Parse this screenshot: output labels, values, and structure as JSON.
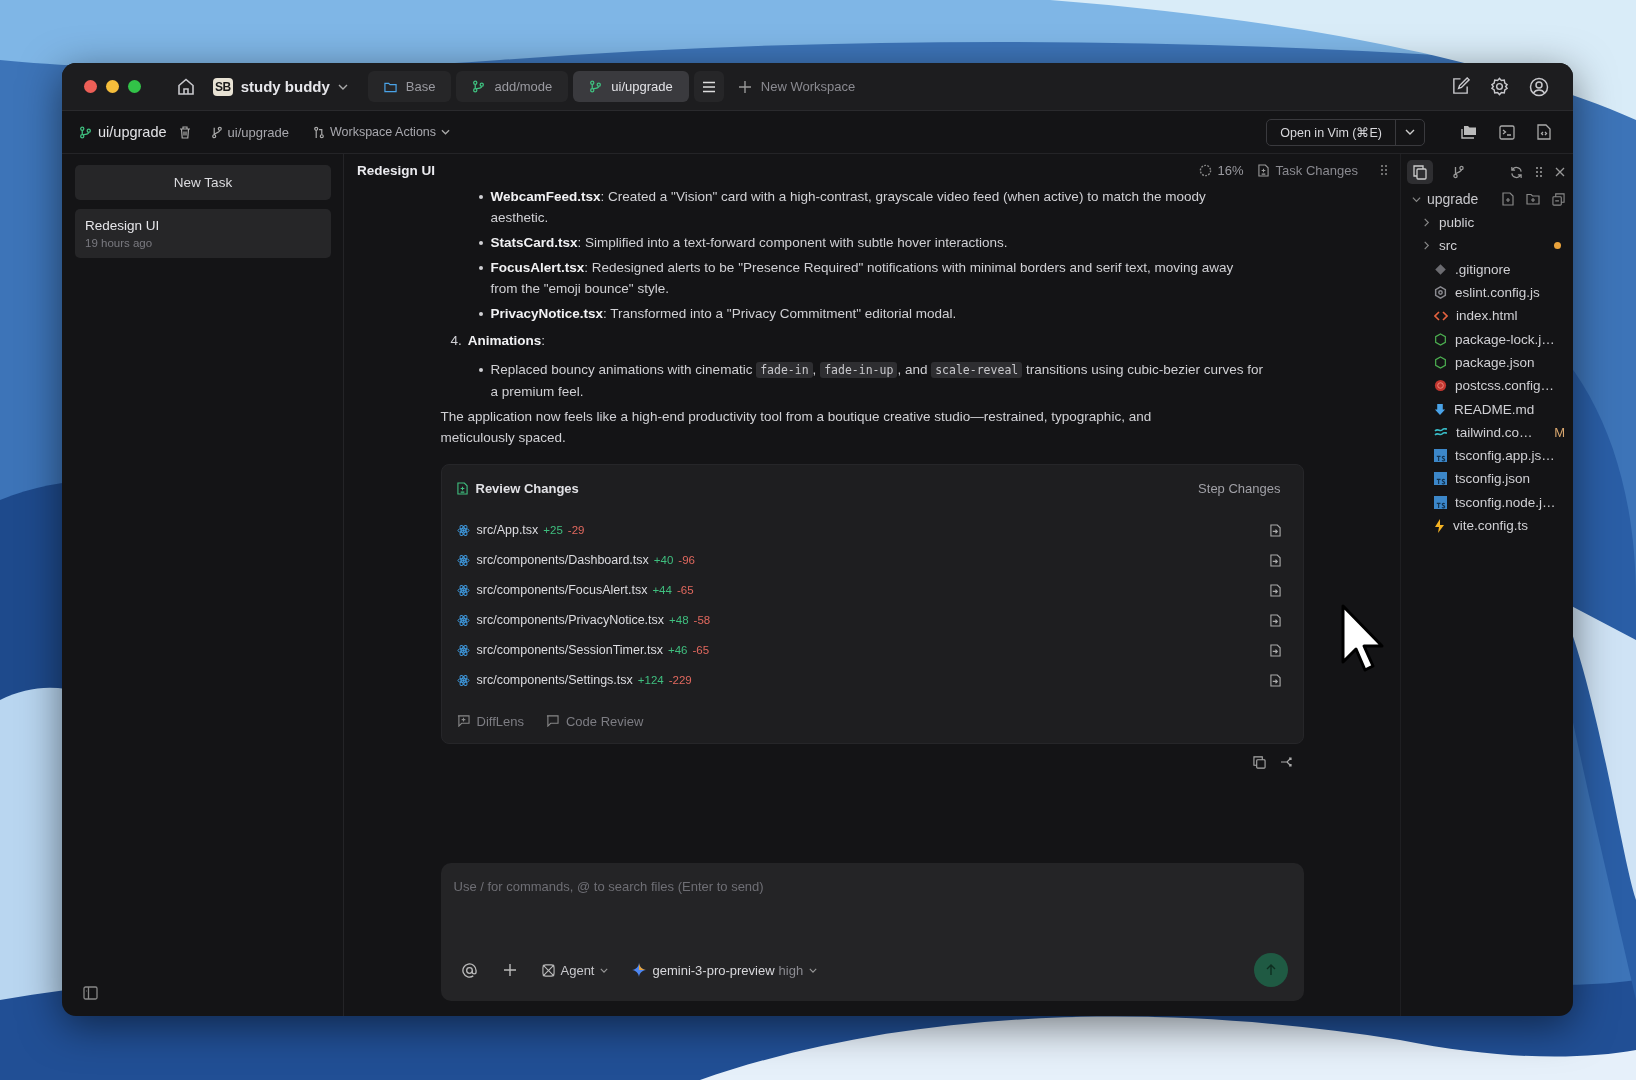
{
  "workspace": {
    "logo": "SB",
    "name": "study buddy"
  },
  "tabs": [
    {
      "label": "Base",
      "kind": "folder",
      "selected": false
    },
    {
      "label": "add/mode",
      "kind": "branch",
      "selected": false
    },
    {
      "label": "ui/upgrade",
      "kind": "branch",
      "selected": true
    }
  ],
  "new_workspace": "New Workspace",
  "toolbar": {
    "workspace": "ui/upgrade",
    "branch": "ui/upgrade",
    "actions": "Workspace Actions",
    "open_button": "Open in Vim (⌘E)"
  },
  "sidebar": {
    "new_task": "New Task",
    "tasks": [
      {
        "title": "Redesign UI",
        "time": "19 hours ago",
        "selected": true
      }
    ]
  },
  "task": {
    "title": "Redesign UI",
    "progress": "16%",
    "changes_button": "Task Changes"
  },
  "message": [
    {
      "kind": "bullets",
      "items": [
        {
          "parts": [
            {
              "kind": "rich",
              "text": "**WebcamFeed.tsx**: Created a \"Vision\" card with a high-contrast, grayscale video feed (when active) to match the moody aesthetic."
            }
          ]
        },
        {
          "parts": [
            {
              "kind": "rich",
              "text": "**StatsCard.tsx**: Simplified into a text-forward component with subtle hover interactions."
            }
          ]
        },
        {
          "parts": [
            {
              "kind": "rich",
              "text": "**FocusAlert.tsx**: Redesigned alerts to be \"Presence Required\" notifications with minimal borders and serif text, moving away from the \"emoji bounce\" style."
            }
          ]
        },
        {
          "parts": [
            {
              "kind": "rich",
              "text": "**PrivacyNotice.tsx**: Transformed into a \"Privacy Commitment\" editorial modal."
            }
          ]
        }
      ]
    },
    {
      "kind": "numbered",
      "number": "4.",
      "title": "Animations",
      "suffix": ":",
      "items": [
        {
          "parts": [
            {
              "kind": "rich",
              "text": "Replaced bouncy animations with cinematic "
            },
            {
              "kind": "code",
              "text": "fade-in"
            },
            {
              "kind": "rich",
              "text": ", "
            },
            {
              "kind": "code",
              "text": "fade-in-up"
            },
            {
              "kind": "rich",
              "text": ", and "
            },
            {
              "kind": "code",
              "text": "scale-reveal"
            },
            {
              "kind": "rich",
              "text": " transitions using cubic-bezier curves for a premium feel."
            }
          ]
        }
      ]
    },
    {
      "kind": "paragraph",
      "text": "The application now feels like a high-end productivity tool from a boutique creative studio—restrained, typographic, and meticulously spaced."
    }
  ],
  "review": {
    "title": "Review Changes",
    "step_button": "Step Changes",
    "files": [
      {
        "path": "src/App.tsx",
        "added": "+25",
        "removed": "-29"
      },
      {
        "path": "src/components/Dashboard.tsx",
        "added": "+40",
        "removed": "-96"
      },
      {
        "path": "src/components/FocusAlert.tsx",
        "added": "+44",
        "removed": "-65"
      },
      {
        "path": "src/components/PrivacyNotice.tsx",
        "added": "+48",
        "removed": "-58"
      },
      {
        "path": "src/components/SessionTimer.tsx",
        "added": "+46",
        "removed": "-65"
      },
      {
        "path": "src/components/Settings.tsx",
        "added": "+124",
        "removed": "-229"
      }
    ],
    "footer": [
      "DiffLens",
      "Code Review"
    ]
  },
  "composer": {
    "placeholder": "Use / for commands, @ to search files (Enter to send)",
    "mode": "Agent",
    "model": "gemini-3-pro-preview",
    "effort": "high"
  },
  "file_tree": {
    "root": "upgrade",
    "expanded": true,
    "items": [
      {
        "name": "public",
        "kind": "folder",
        "expanded": false,
        "modified": false
      },
      {
        "name": "src",
        "kind": "folder",
        "expanded": false,
        "modified": true
      },
      {
        "name": ".gitignore",
        "kind": "git"
      },
      {
        "name": "eslint.config.js",
        "kind": "eslint"
      },
      {
        "name": "index.html",
        "kind": "html"
      },
      {
        "name": "package-lock.j…",
        "kind": "json"
      },
      {
        "name": "package.json",
        "kind": "json"
      },
      {
        "name": "postcss.config…",
        "kind": "postcss"
      },
      {
        "name": "README.md",
        "kind": "markdown"
      },
      {
        "name": "tailwind.co…",
        "kind": "tailwind",
        "badge": "M"
      },
      {
        "name": "tsconfig.app.js…",
        "kind": "ts"
      },
      {
        "name": "tsconfig.json",
        "kind": "ts"
      },
      {
        "name": "tsconfig.node.j…",
        "kind": "ts"
      },
      {
        "name": "vite.config.ts",
        "kind": "vite"
      }
    ]
  }
}
